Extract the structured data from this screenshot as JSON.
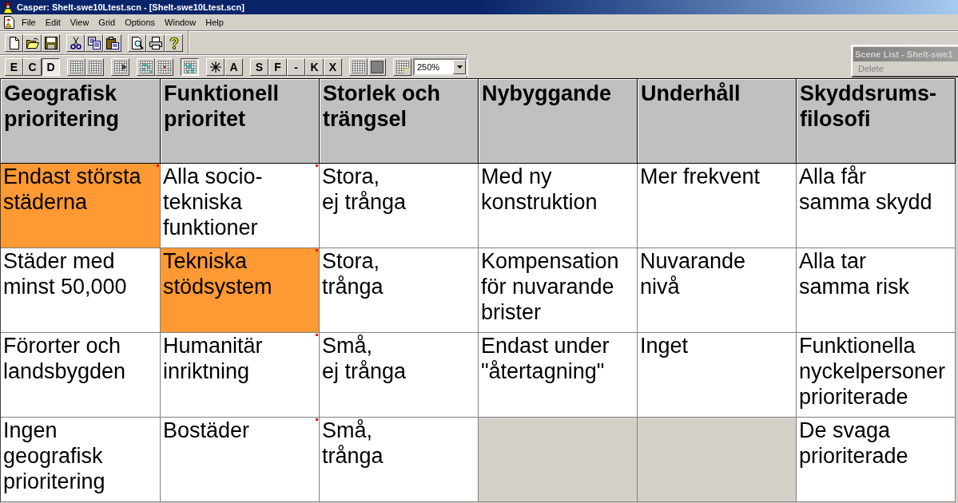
{
  "window": {
    "title": "Casper: Shelt-swe10Ltest.scn - [Shelt-swe10Ltest.scn]"
  },
  "menu": [
    "File",
    "Edit",
    "View",
    "Grid",
    "Options",
    "Window",
    "Help"
  ],
  "format_toolbar": [
    [
      {
        "kind": "letter",
        "label": "E",
        "pressed": false
      },
      {
        "kind": "letter",
        "label": "C",
        "pressed": false
      },
      {
        "kind": "letter",
        "label": "D",
        "pressed": true
      }
    ],
    [
      {
        "kind": "grid",
        "pressed": false
      },
      {
        "kind": "grid",
        "pressed": false
      }
    ],
    [
      {
        "kind": "grid-arrow",
        "pressed": false
      }
    ],
    [
      {
        "kind": "grid-cyan",
        "pressed": false
      },
      {
        "kind": "grid-dot",
        "pressed": false
      }
    ],
    [
      {
        "kind": "grid-scatter",
        "pressed": true
      }
    ],
    [
      {
        "kind": "asterisk",
        "pressed": false
      },
      {
        "kind": "letter",
        "label": "A",
        "pressed": false
      }
    ],
    [
      {
        "kind": "letter",
        "label": "S",
        "pressed": false
      },
      {
        "kind": "letter",
        "label": "F",
        "pressed": false
      },
      {
        "kind": "letter",
        "label": "-",
        "pressed": false
      },
      {
        "kind": "letter",
        "label": "K",
        "pressed": false
      },
      {
        "kind": "letter",
        "label": "X",
        "pressed": false
      }
    ],
    [
      {
        "kind": "grid",
        "pressed": false
      },
      {
        "kind": "square",
        "pressed": false
      }
    ],
    [
      {
        "kind": "grid-corner",
        "pressed": false
      }
    ]
  ],
  "zoom": {
    "value": "250%"
  },
  "scene_list": {
    "title": "Scene List - Shelt-swe1",
    "items": [
      {
        "label": "Delete",
        "disabled": true
      }
    ]
  },
  "columns": [
    {
      "header": "Geografisk\nprioritering",
      "cells": [
        {
          "text": "Endast största\nstäderna",
          "selected": true,
          "flagged": true
        },
        {
          "text": "Städer med\nminst 50,000",
          "selected": false,
          "flagged": false
        },
        {
          "text": "Förorter och\nlandsbygden",
          "selected": false,
          "flagged": false
        },
        {
          "text": "Ingen\ngeografisk\nprioritering",
          "selected": false,
          "flagged": false
        }
      ]
    },
    {
      "header": "Funktionell\nprioritet",
      "cells": [
        {
          "text": "Alla socio-\ntekniska\nfunktioner",
          "selected": false,
          "flagged": true
        },
        {
          "text": "Tekniska\nstödsystem",
          "selected": true,
          "flagged": true
        },
        {
          "text": "Humanitär\ninriktning",
          "selected": false,
          "flagged": true
        },
        {
          "text": "Bostäder",
          "selected": false,
          "flagged": true
        }
      ]
    },
    {
      "header": "Storlek och\nträngsel",
      "cells": [
        {
          "text": "Stora,\nej trånga",
          "selected": false,
          "flagged": false
        },
        {
          "text": "Stora,\ntrånga",
          "selected": false,
          "flagged": false
        },
        {
          "text": "Små,\nej trånga",
          "selected": false,
          "flagged": false
        },
        {
          "text": "Små,\ntrånga",
          "selected": false,
          "flagged": false
        }
      ]
    },
    {
      "header": "Nybyggande",
      "cells": [
        {
          "text": "Med ny\nkonstruktion",
          "selected": false,
          "flagged": false
        },
        {
          "text": "Kompensation\nför nuvarande\nbrister",
          "selected": false,
          "flagged": false
        },
        {
          "text": "Endast under\n\"återtagning\"",
          "selected": false,
          "flagged": false
        }
      ]
    },
    {
      "header": "Underhåll",
      "cells": [
        {
          "text": "Mer frekvent",
          "selected": false,
          "flagged": false
        },
        {
          "text": "Nuvarande\nnivå",
          "selected": false,
          "flagged": false
        },
        {
          "text": "Inget",
          "selected": false,
          "flagged": false
        }
      ]
    },
    {
      "header": "Skyddsrums-\nfilosofi",
      "cells": [
        {
          "text": "Alla får\nsamma skydd",
          "selected": false,
          "flagged": false
        },
        {
          "text": "Alla tar\nsamma risk",
          "selected": false,
          "flagged": false
        },
        {
          "text": "Funktionella\nnyckelpersoner\nprioriterade",
          "selected": false,
          "flagged": false
        },
        {
          "text": "De svaga\nprioriterade",
          "selected": false,
          "flagged": false
        }
      ]
    }
  ]
}
